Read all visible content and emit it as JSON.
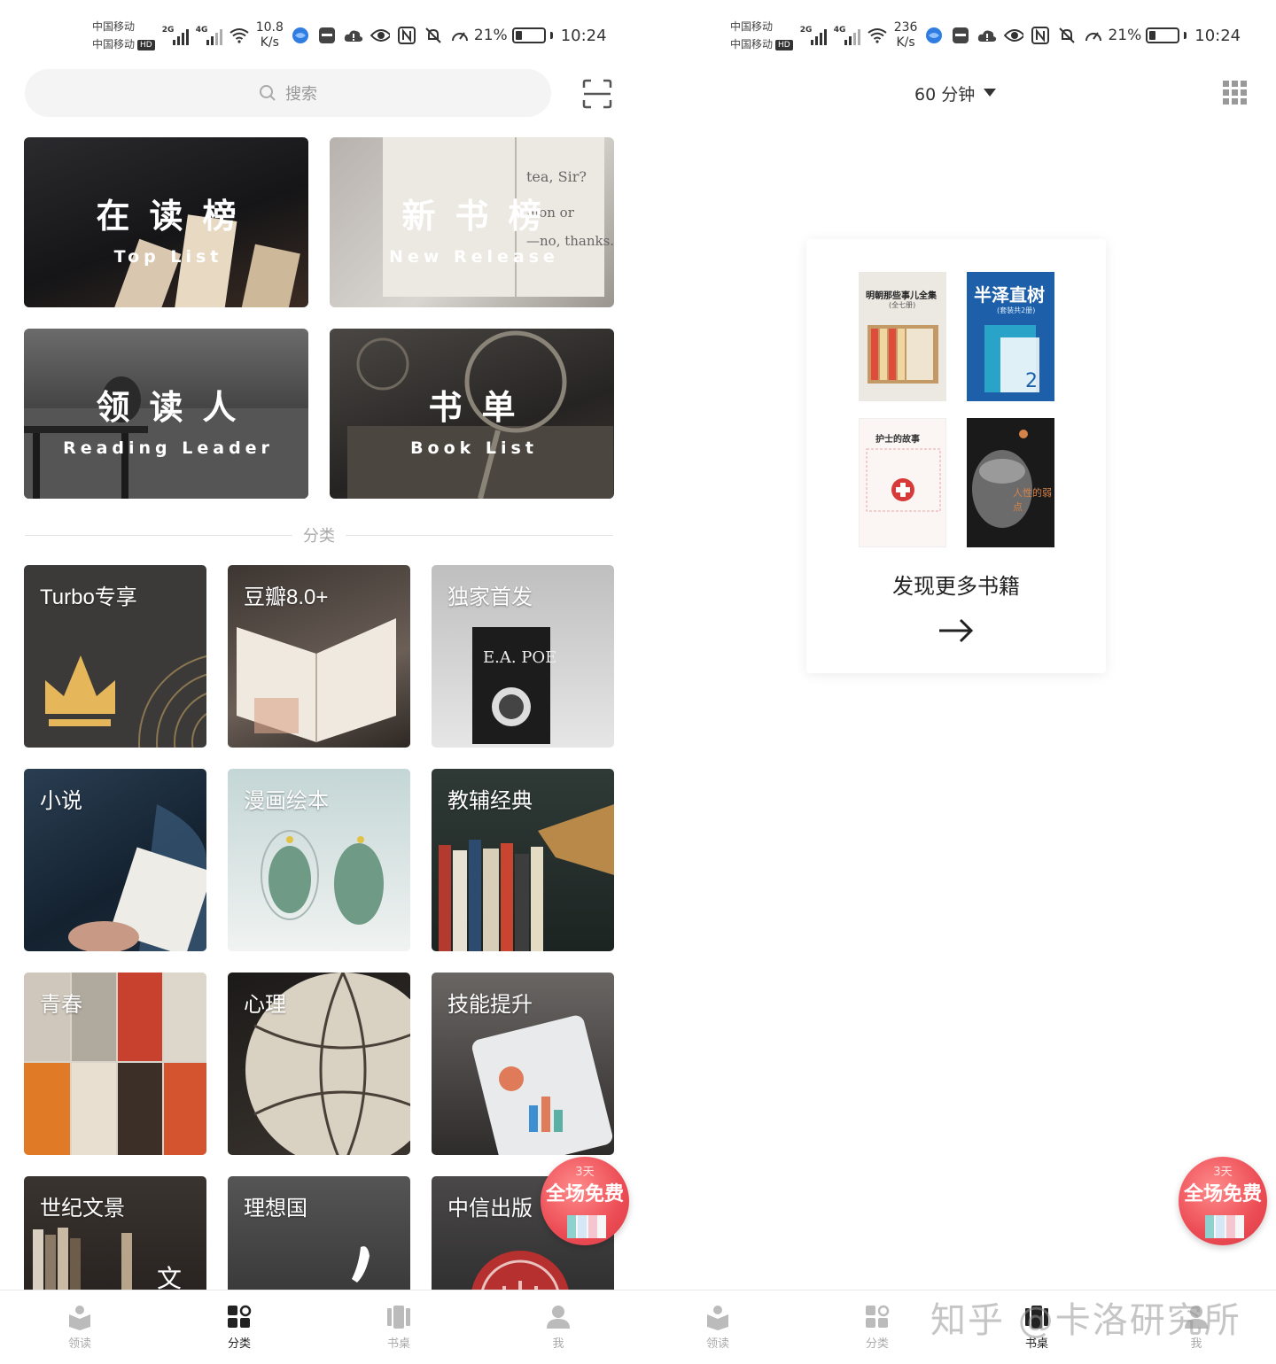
{
  "left": {
    "status": {
      "carrier1": "中国移动",
      "carrier2": "中国移动",
      "hd": "HD",
      "sig1": "2G",
      "sig2": "4G",
      "speed": "10.8",
      "speed_unit": "K/s",
      "battery": "21%",
      "time": "10:24"
    },
    "search": {
      "placeholder": "搜索"
    },
    "heroes": [
      {
        "title": "在读榜",
        "subtitle": "Top List"
      },
      {
        "title": "新书榜",
        "subtitle": "New Release"
      },
      {
        "title": "领读人",
        "subtitle": "Reading Leader"
      },
      {
        "title": "书单",
        "subtitle": "Book List"
      }
    ],
    "divider_label": "分类",
    "categories": [
      "Turbo专享",
      "豆瓣8.0+",
      "独家首发",
      "小说",
      "漫画绘本",
      "教辅经典",
      "青春",
      "心理",
      "技能提升",
      "世纪文景",
      "理想国",
      "中信出版"
    ]
  },
  "right": {
    "status": {
      "carrier1": "中国移动",
      "carrier2": "中国移动",
      "hd": "HD",
      "sig1": "2G",
      "sig2": "4G",
      "speed": "236",
      "speed_unit": "K/s",
      "battery": "21%",
      "time": "10:24"
    },
    "timer": "60 分钟",
    "books": [
      {
        "title": "明朝那些事儿全集",
        "sub": "(全七册)"
      },
      {
        "title": "半泽直树",
        "sub": "(套装共2册)"
      },
      {
        "title": "护士的故事",
        "sub": ""
      },
      {
        "title": "人性的弱点",
        "sub": ""
      }
    ],
    "discover": "发现更多书籍",
    "watermark": "知乎 @卡洛研究所"
  },
  "promo": {
    "days": "3天",
    "text": "全场免费"
  },
  "nav": [
    "领读",
    "分类",
    "书桌",
    "我"
  ],
  "colors": {
    "promo": "#ec4d55",
    "gold": "#e6b65a",
    "text": "#222222",
    "muted": "#aaaaaa"
  }
}
